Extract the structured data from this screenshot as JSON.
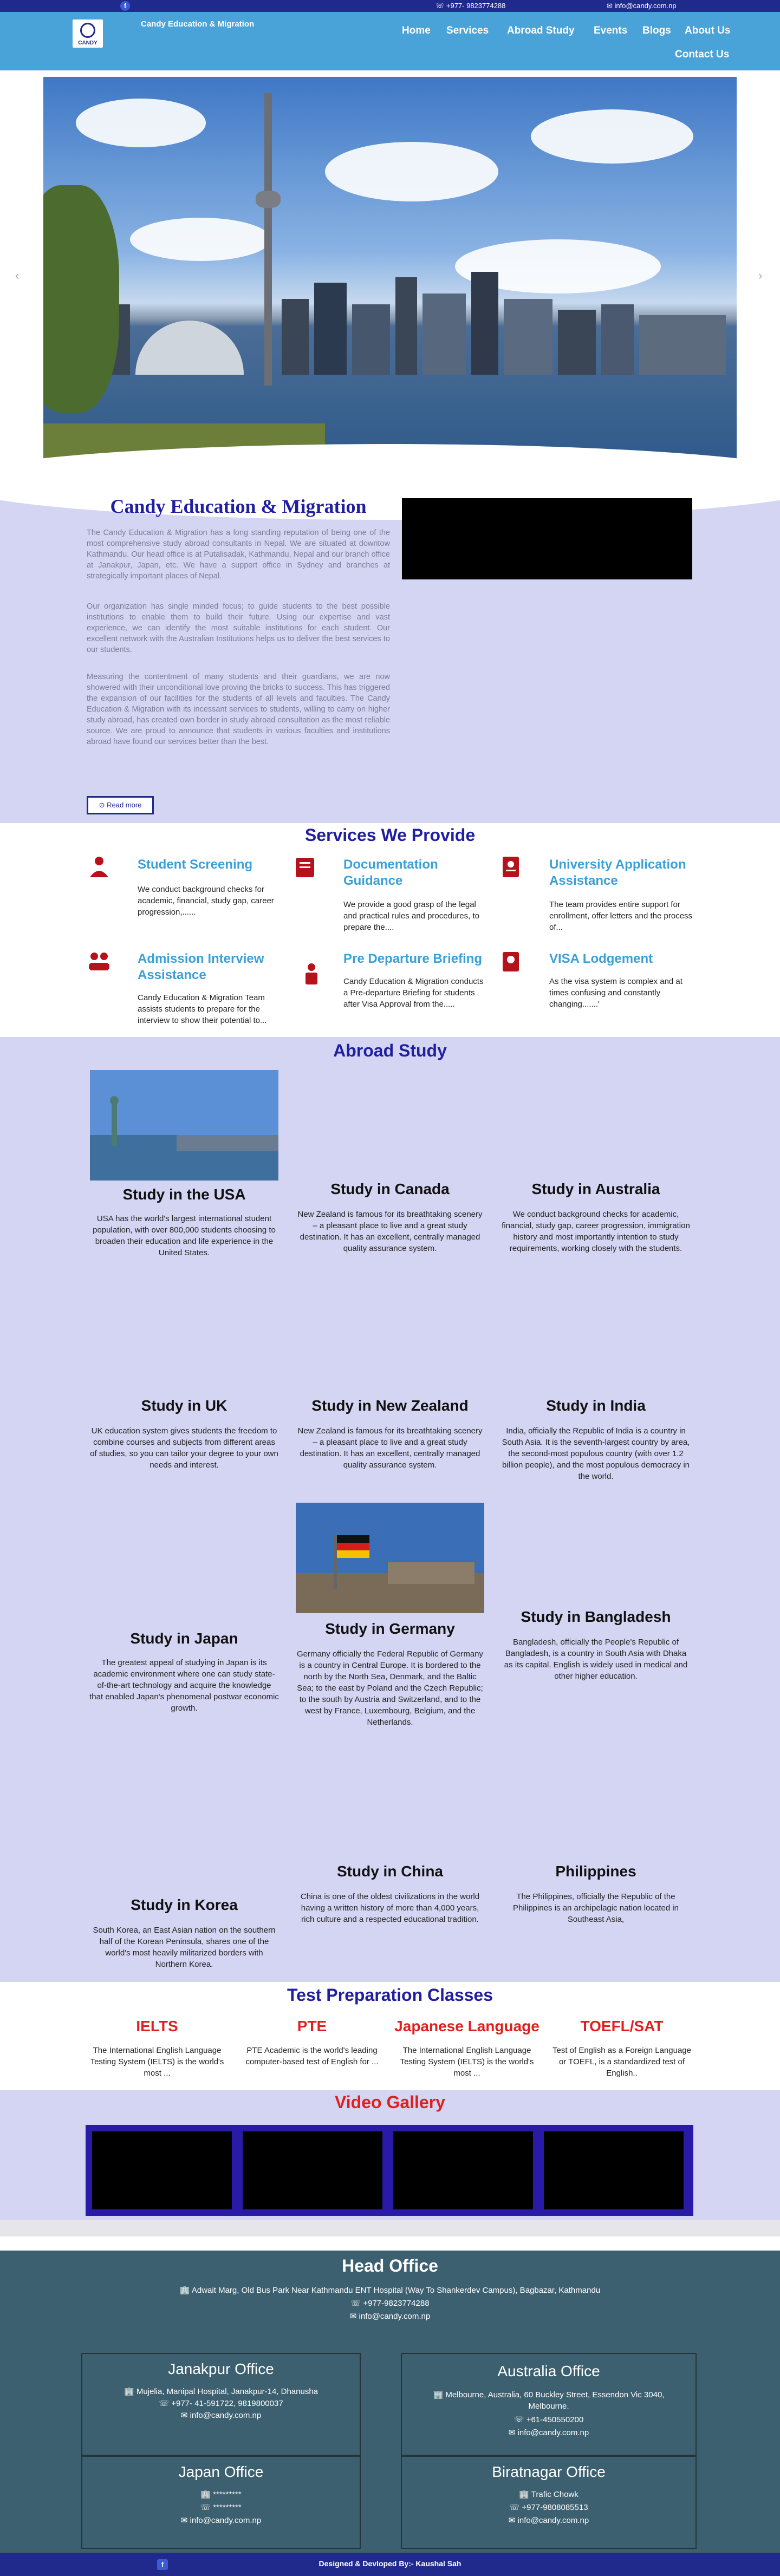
{
  "topbar": {
    "phone": "☏ +977- 9823774288",
    "email": "✉ info@candy.com.np"
  },
  "header": {
    "logo_word": "CANDY",
    "brand": "Candy Education & Migration",
    "nav": [
      "Home",
      "Services",
      "Abroad Study",
      "Events",
      "Blogs",
      "About Us",
      "Contact Us"
    ]
  },
  "about": {
    "title": "Candy Education & Migration",
    "paragraphs": [
      "The Candy Education & Migration has a long standing reputation of being one of the most comprehensive study abroad consultants in Nepal. We are situated at downtow Kathmandu. Our head office is at Putalisadak, Kathmandu, Nepal and our branch office at Janakpur, Japan, etc. We have a support office in Sydney and branches at strategically important places of Nepal.",
      "Our organization has single minded focus; to guide students to the best possible institutions to enable them to build their future. Using our expertise and vast experience, we can identify the most suitable institutions for each student. Our excellent network with the Australian Institutions helps us to deliver the best services to our students.",
      "Measuring the contentment of many students and their guardians, we are now showered with their unconditional love proving the bricks to success. This has triggered the expansion of our facilities for the students of all levels and faculties. The Candy Education & Migration with its incessant services to students, willing to carry on higher study abroad, has created own border in study abroad consultation as the most reliable source. We are proud to announce that students in various faculties and institutions abroad have found our services better than the best."
    ],
    "read_more": "⊙ Read more"
  },
  "services": {
    "title": "Services We Provide",
    "items": [
      {
        "title": "Student Screening",
        "text": "We conduct background checks for academic, financial, study gap, career progression,......"
      },
      {
        "title": "Documentation Guidance",
        "text": "We provide a good grasp of the legal and practical rules and procedures, to prepare the...."
      },
      {
        "title": "University Application Assistance",
        "text": "The team provides entire support for enrollment, offer letters and the process of..."
      },
      {
        "title": "Admission Interview Assistance",
        "text": "Candy Education & Migration Team assists students to prepare for the interview to show their potential to..."
      },
      {
        "title": "Pre Departure Briefing",
        "text": "Candy Education & Migration conducts a Pre-departure Briefing for students after Visa Approval from the....."
      },
      {
        "title": "VISA Lodgement",
        "text": "As the visa system is complex and at times confusing and constantly changing.......'"
      }
    ]
  },
  "abroad": {
    "title": "Abroad Study",
    "countries": [
      {
        "title": "Study in the USA",
        "text": "USA has the world's largest international student population, with over 800,000 students choosing to broaden their education and life experience in the United States."
      },
      {
        "title": "Study in Canada",
        "text": "New Zealand is famous for its breathtaking scenery – a pleasant place to live and a great study destination. It has an excellent, centrally managed quality assurance system."
      },
      {
        "title": "Study in Australia",
        "text": "We conduct background checks for academic, financial, study gap, career progression, immigration history and most importantly intention to study requirements, working closely with the students."
      },
      {
        "title": "Study in UK",
        "text": "UK education system gives students the freedom to combine courses and subjects from different areas of studies, so you can tailor your degree to your own needs and interest."
      },
      {
        "title": "Study in New Zealand",
        "text": "New Zealand is famous for its breathtaking scenery – a pleasant place to live and a great study destination. It has an excellent, centrally managed quality assurance system."
      },
      {
        "title": "Study in India",
        "text": "India, officially the Republic of India is a country in South Asia. It is the seventh-largest country by area, the second-most populous country (with over 1.2 billion people), and the most populous democracy in the world."
      },
      {
        "title": "Study in Japan",
        "text": "The greatest appeal of studying in Japan is its academic environment where one can study state-of-the-art technology and acquire the knowledge that enabled Japan's phenomenal postwar economic growth."
      },
      {
        "title": "Study in Germany",
        "text": "Germany officially the Federal Republic of Germany is a country in Central Europe. It is bordered to the north by the North Sea, Denmark, and the Baltic Sea; to the east by Poland and the Czech Republic; to the south by Austria and Switzerland, and to the west by France, Luxembourg, Belgium, and the Netherlands."
      },
      {
        "title": "Study in Bangladesh",
        "text": "Bangladesh, officially the People's Republic of Bangladesh, is a country in South Asia with Dhaka as its capital. English is widely used in medical and other higher education."
      },
      {
        "title": "Study in Korea",
        "text": "South Korea, an East Asian nation on the southern half of the Korean Peninsula, shares one of the world's most heavily militarized borders with Northern Korea."
      },
      {
        "title": "Study in China",
        "text": "China is one of the oldest civilizations in the world having a written history of more than 4,000 years, rich culture and a respected educational tradition."
      },
      {
        "title": "Philippines",
        "text": "The Philippines, officially the Republic of the Philippines is an archipelagic nation located in Southeast Asia,"
      }
    ]
  },
  "test_prep": {
    "title": "Test Preparation Classes",
    "items": [
      {
        "title": "IELTS",
        "text": "The International English Language Testing System (IELTS) is the world's most ..."
      },
      {
        "title": "PTE",
        "text": "PTE Academic is the world's leading computer-based test of English for ..."
      },
      {
        "title": "Japanese Language",
        "text": "The International English Language Testing System (IELTS) is the world's most ..."
      },
      {
        "title": "TOEFL/SAT",
        "text": "Test of English as a Foreign Language or TOEFL, is a standardized test of English.."
      }
    ]
  },
  "gallery": {
    "title": "Video Gallery"
  },
  "footer": {
    "head_office": {
      "title": "Head Office",
      "address": "🏢 Adwait Marg, Old Bus Park Near Kathmandu ENT Hospital  (Way To Shankerdev Campus), Bagbazar, Kathmandu",
      "phone": "☏ +977-9823774288",
      "email": "✉ info@candy.com.np"
    },
    "offices": [
      {
        "title": "Janakpur Office",
        "lines": [
          "🏢 Mujelia, Manipal Hospital, Janakpur-14, Dhanusha",
          "☏ +977- 41-591722, 9819800037",
          "✉ info@candy.com.np"
        ]
      },
      {
        "title": "Australia Office",
        "lines": [
          "🏢 Melbourne, Australia, 60 Buckley Street, Essendon Vic 3040,",
          "Melbourne.",
          "☏ +61-450550200",
          "✉ info@candy.com.np"
        ]
      },
      {
        "title": "Japan Office",
        "lines": [
          "🏢 *********",
          "☏ *********",
          "✉ info@candy.com.np"
        ]
      },
      {
        "title": "Biratnagar Office",
        "lines": [
          "🏢 Trafic Chowk",
          "☏ +977-9808085513",
          "✉ info@candy.com.np"
        ]
      }
    ],
    "credit": "Designed & Devloped By:- Kaushal Sah"
  },
  "icons": {
    "facebook": "facebook-icon",
    "phone": "phone-icon",
    "email": "email-icon",
    "building": "building-icon"
  },
  "colors": {
    "navy": "#1f2a8c",
    "header_blue": "#4aa3d8",
    "lavender": "#d4d5f3",
    "service_blue": "#3aa0d6",
    "test_red": "#e01f1f",
    "footer_teal": "#3d6070"
  }
}
